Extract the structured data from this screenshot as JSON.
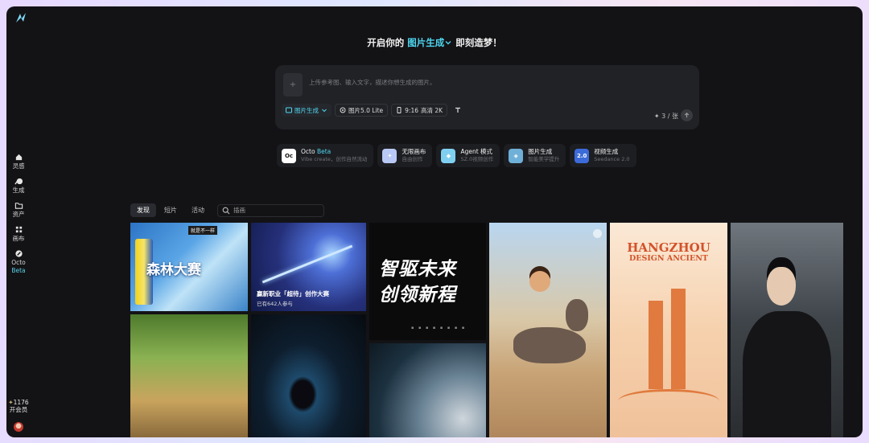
{
  "headline": {
    "prefix": "开启你的",
    "mode": "图片生成",
    "suffix": "即刻造梦！"
  },
  "prompt": {
    "upload_icon": "+",
    "placeholder": "上传参考图、输入文字，描述你想生成的图片。",
    "mode_label": "图片生成",
    "model_label": "图片5.0 Lite",
    "ratio_label": "9:16",
    "quality_label": "高清 2K",
    "cost": "3 / 张"
  },
  "sidebar": {
    "items": [
      {
        "label": "灵感",
        "icon": "home-icon"
      },
      {
        "label": "生成",
        "icon": "generate-icon"
      },
      {
        "label": "资产",
        "icon": "folder-icon"
      },
      {
        "label": "画布",
        "icon": "canvas-icon"
      },
      {
        "label": "Octo",
        "sub": "Beta",
        "icon": "octo-icon"
      }
    ],
    "vip_count": "1176",
    "vip_label": "开会员"
  },
  "cards": [
    {
      "title": "Octo",
      "badge": "Beta",
      "sub": "Vibe create，创作自然流动",
      "icon": "Oc",
      "color": "#ffffff"
    },
    {
      "title": "无限画布",
      "sub": "自由创作",
      "icon": "✦",
      "color": "#b9c9f5"
    },
    {
      "title": "Agent 模式",
      "sub": "SZ.0视频创作",
      "icon": "◆",
      "color": "#7fd0f0"
    },
    {
      "title": "图片生成",
      "sub": "智能美学提升",
      "icon": "◈",
      "color": "#6fb0d8"
    },
    {
      "title": "视频生成",
      "sub": "Seedance 2.0",
      "icon": "2.0",
      "color": "#3c6bd9"
    }
  ],
  "tabs": [
    {
      "label": "发现",
      "active": true
    },
    {
      "label": "短片",
      "active": false
    },
    {
      "label": "活动",
      "active": false
    }
  ],
  "search": {
    "placeholder": "插画"
  },
  "gallery": {
    "beer_title": "森林大赛",
    "beer_badge": "就是不一样",
    "mecha_caption": "赢新职业「超待」创作大赛",
    "mecha_sub": "已有642人参与",
    "callig_line1": "智驱未来",
    "callig_line2": "创领新程",
    "callig_dots": "▪ ▪ ▪ ▪ ▪ ▪ ▪ ▪",
    "hz_title": "HANGZHOU",
    "hz_sub": "DESIGN ANCIENT"
  }
}
